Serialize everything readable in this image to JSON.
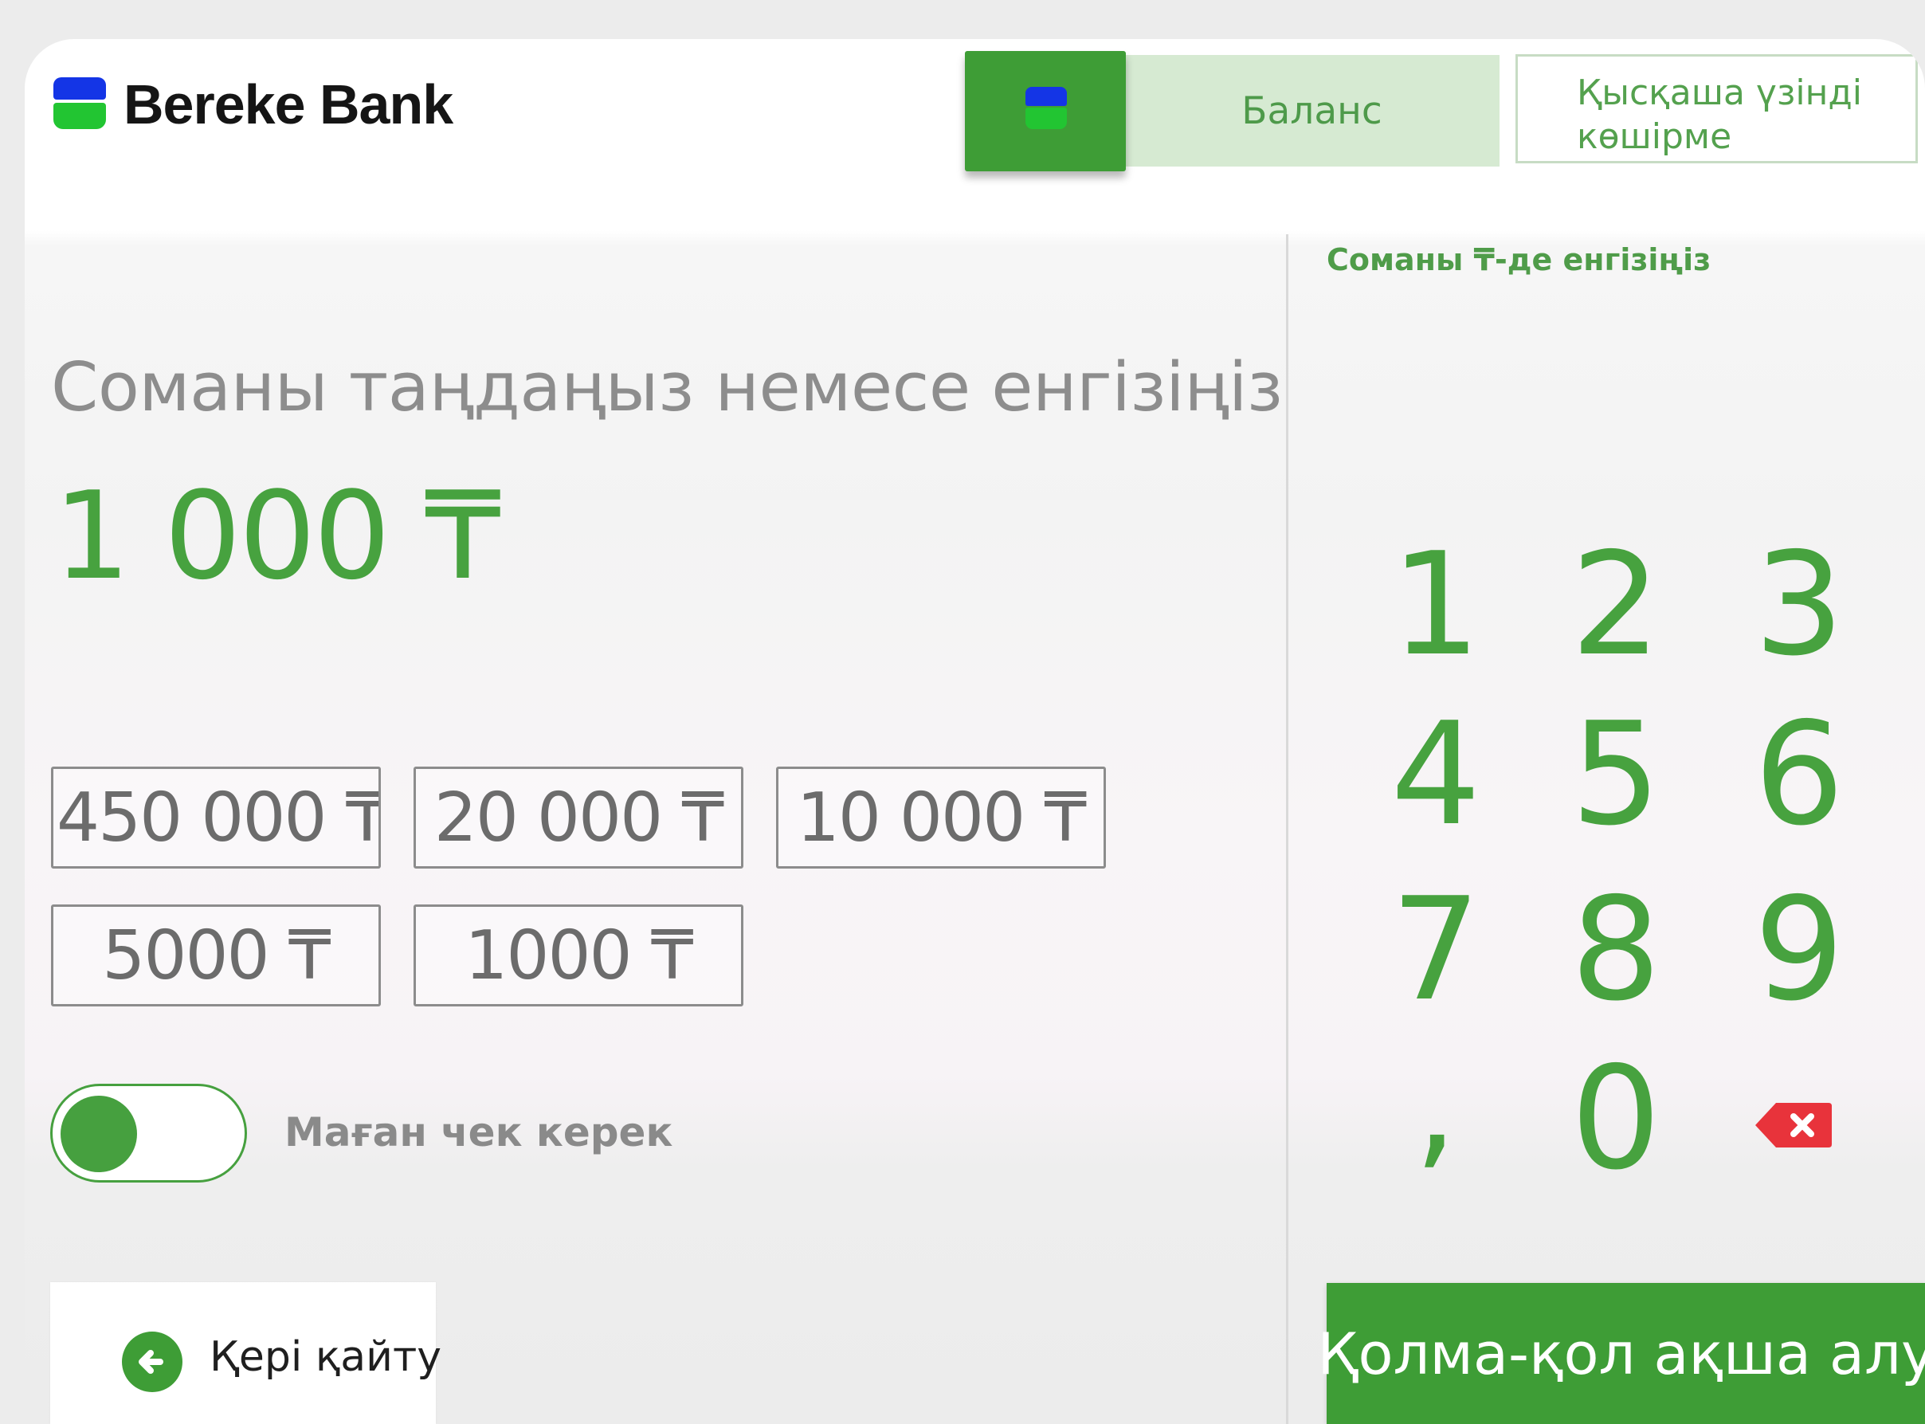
{
  "header": {
    "brand": "Bereke Bank",
    "tabs": [
      {
        "label": "Баланс"
      },
      {
        "label": "Қысқаша үзінді көшірме",
        "lines": [
          "Қысқаша үзінді",
          "көшірме"
        ]
      }
    ]
  },
  "main": {
    "prompt": "Соманы таңдаңыз немесе енгізіңіз",
    "amount": "1 000 ₸",
    "presets": [
      "450 000 ₸",
      "20 000 ₸",
      "10 000 ₸",
      "5000 ₸",
      "1000 ₸"
    ],
    "receipt_toggle": {
      "label": "Маған чек керек",
      "on": true
    },
    "back_label": "Қері қайту"
  },
  "keypad": {
    "label": "Соманы ₸-де енгізіңіз",
    "keys": [
      "1",
      "2",
      "3",
      "4",
      "5",
      "6",
      "7",
      "8",
      "9",
      ",",
      "0"
    ],
    "backspace_icon": "backspace-icon"
  },
  "action": {
    "withdraw_label": "Қолма-қол ақша алу"
  },
  "colors": {
    "accent": "#3e9d36",
    "brand_blue": "#1435e6",
    "brand_green": "#22c532",
    "backspace_red": "#e8333b"
  }
}
